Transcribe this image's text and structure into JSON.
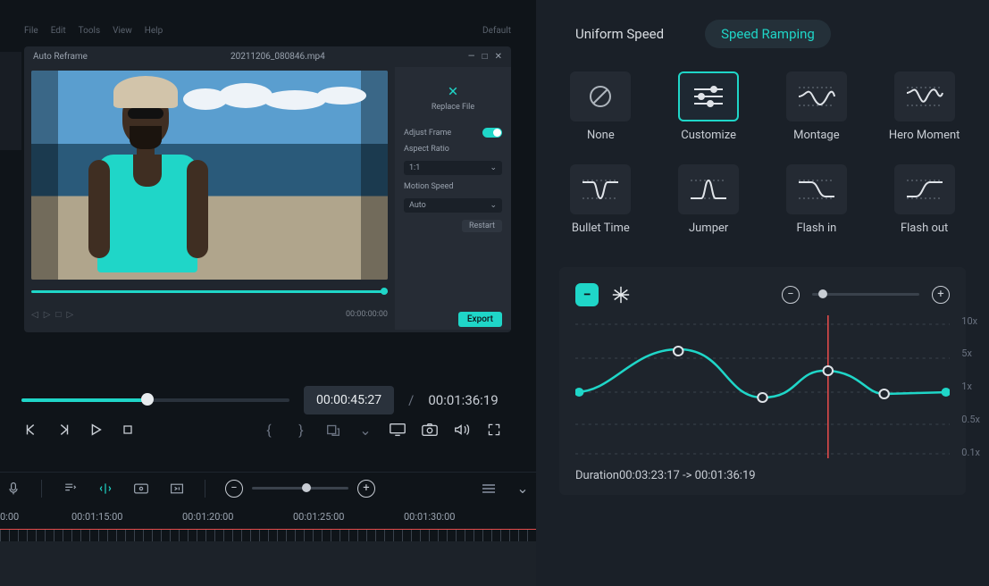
{
  "menubar": {
    "items": [
      "File",
      "Edit",
      "Tools",
      "View",
      "Help"
    ],
    "right": "Default"
  },
  "reframe": {
    "title": "Auto Reframe",
    "filename": "20211206_080846.mp4",
    "replace_label": "Replace File",
    "adjust_label": "Adjust Frame",
    "aspect_label": "Aspect Ratio",
    "aspect_value": "1:1",
    "motion_label": "Motion Speed",
    "motion_value": "Auto",
    "restart_label": "Restart",
    "export_label": "Export",
    "mini_time": "00:00:00:00"
  },
  "preview": {
    "current": "00:00:45:27",
    "total": "00:01:36:19"
  },
  "ruler": {
    "t0": "0:00",
    "t1": "00:01:15:00",
    "t2": "00:01:20:00",
    "t3": "00:01:25:00",
    "t4": "00:01:30:00"
  },
  "speed": {
    "tab_uniform": "Uniform Speed",
    "tab_ramping": "Speed Ramping",
    "presets": {
      "none": "None",
      "customize": "Customize",
      "montage": "Montage",
      "hero": "Hero Moment",
      "bullet": "Bullet Time",
      "jumper": "Jumper",
      "flashin": "Flash in",
      "flashout": "Flash out"
    },
    "ylabels": {
      "a": "10x",
      "b": "5x",
      "c": "1x",
      "d": "0.5x",
      "e": "0.1x"
    },
    "duration_label": "Duration",
    "duration_value": "00:03:23:17 -> 00:01:36:19"
  }
}
